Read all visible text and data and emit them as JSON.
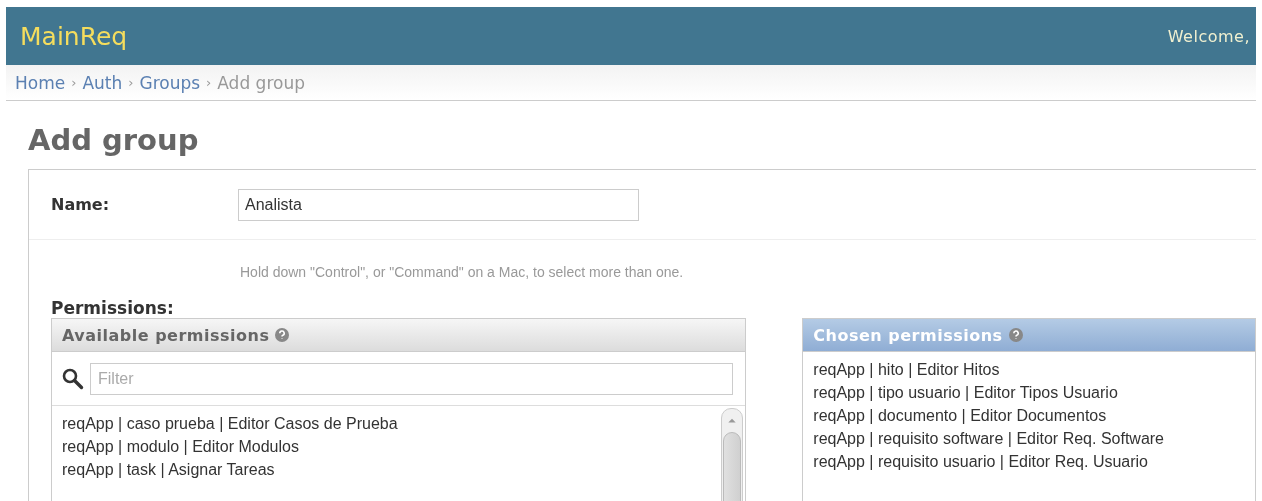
{
  "header": {
    "brand": "MainReq",
    "welcome": "Welcome,"
  },
  "breadcrumbs": {
    "separator": "›",
    "items": [
      {
        "label": "Home",
        "kind": "link"
      },
      {
        "label": "Auth",
        "kind": "link"
      },
      {
        "label": "Groups",
        "kind": "link"
      },
      {
        "label": "Add group",
        "kind": "current"
      }
    ]
  },
  "title": "Add group",
  "name_field": {
    "label": "Name:",
    "value": "Analista"
  },
  "help_text": "Hold down \"Control\", or \"Command\" on a Mac, to select more than one.",
  "permissions": {
    "label": "Permissions:",
    "available": {
      "title": "Available permissions",
      "filter_placeholder": "Filter",
      "items": [
        "reqApp | caso prueba | Editor Casos de Prueba",
        "reqApp | modulo | Editor Modulos",
        "reqApp | task | Asignar Tareas"
      ]
    },
    "chosen": {
      "title": "Chosen permissions",
      "items": [
        "reqApp | hito | Editor Hitos",
        "reqApp | tipo usuario | Editor Tipos Usuario",
        "reqApp | documento | Editor Documentos",
        "reqApp | requisito software | Editor Req. Software",
        "reqApp | requisito usuario | Editor Req. Usuario"
      ]
    }
  }
}
